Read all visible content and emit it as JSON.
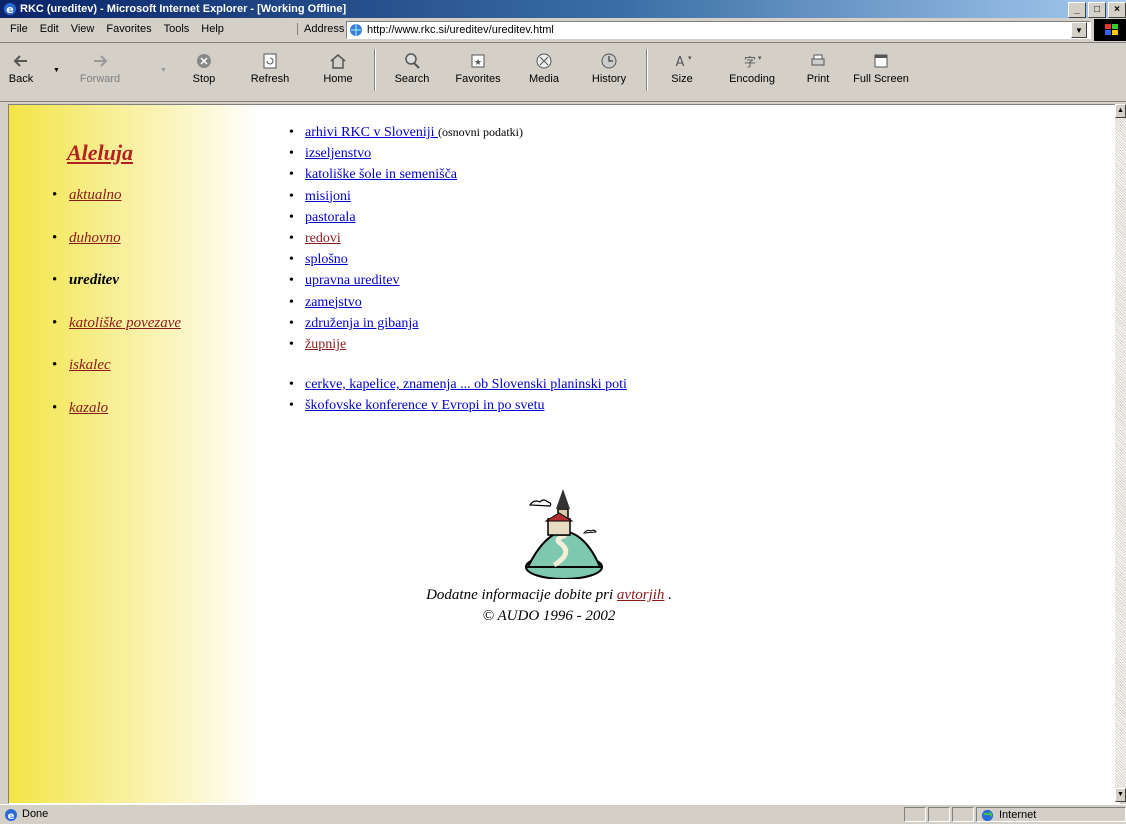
{
  "window": {
    "title": "RKC (ureditev) - Microsoft Internet Explorer - [Working Offline]",
    "buttons": [
      "_",
      "□",
      "×"
    ]
  },
  "menubar": {
    "items": [
      "File",
      "Edit",
      "View",
      "Favorites",
      "Tools",
      "Help"
    ],
    "address_label": "Address",
    "url": "http://www.rkc.si/ureditev/ureditev.html"
  },
  "toolbar": {
    "buttons": [
      {
        "label": "Back",
        "icon": "back-arrow-icon",
        "enabled": true
      },
      {
        "label": "Forward",
        "icon": "forward-arrow-icon",
        "enabled": false
      },
      {
        "label": "Stop",
        "icon": "stop-icon",
        "enabled": true
      },
      {
        "label": "Refresh",
        "icon": "refresh-icon",
        "enabled": true
      },
      {
        "label": "Home",
        "icon": "home-icon",
        "enabled": true
      },
      {
        "label": "Search",
        "icon": "search-icon",
        "enabled": true
      },
      {
        "label": "Favorites",
        "icon": "favorites-icon",
        "enabled": true
      },
      {
        "label": "Media",
        "icon": "media-icon",
        "enabled": true
      },
      {
        "label": "History",
        "icon": "history-icon",
        "enabled": true
      },
      {
        "label": "Size",
        "icon": "text-size-icon",
        "enabled": true
      },
      {
        "label": "Encoding",
        "icon": "encoding-icon",
        "enabled": true
      },
      {
        "label": "Print",
        "icon": "print-icon",
        "enabled": true
      },
      {
        "label": "Full Screen",
        "icon": "full-screen-icon",
        "enabled": true
      }
    ]
  },
  "page": {
    "brand": "Aleluja",
    "nav": [
      {
        "label": "aktualno",
        "current": false
      },
      {
        "label": "duhovno",
        "current": false
      },
      {
        "label": "ureditev",
        "current": true
      },
      {
        "label": "katoliške povezave",
        "current": false
      },
      {
        "label": "iskalec",
        "current": false
      },
      {
        "label": "kazalo",
        "current": false
      }
    ],
    "links": [
      {
        "label": "arhivi RKC v Sloveniji ",
        "note": "(osnovni podatki)",
        "visited": false
      },
      {
        "label": "izseljenstvo",
        "note": "",
        "visited": false
      },
      {
        "label": "katoliške šole in semenišča",
        "note": "",
        "visited": false
      },
      {
        "label": "misijoni",
        "note": "",
        "visited": false
      },
      {
        "label": "pastorala",
        "note": "",
        "visited": false
      },
      {
        "label": "redovi",
        "note": "",
        "visited": true
      },
      {
        "label": "splošno",
        "note": "",
        "visited": false
      },
      {
        "label": "upravna ureditev",
        "note": "",
        "visited": false
      },
      {
        "label": "zamejstvo",
        "note": "",
        "visited": false
      },
      {
        "label": "združenja in gibanja",
        "note": "",
        "visited": false
      },
      {
        "label": "župnije",
        "note": "",
        "visited": true
      }
    ],
    "links2": [
      {
        "label": "cerkve, kapelice, znamenja ... ob Slovenski planinski poti"
      },
      {
        "label": "škofovske konference v Evropi in po svetu"
      }
    ],
    "footer": {
      "text_before": "Dodatne informacije dobite pri ",
      "link": "avtorjih",
      "text_after": " .",
      "copyright": "© AUDO 1996 - 2002"
    }
  },
  "statusbar": {
    "status": "Done",
    "zone": "Internet"
  },
  "colors": {
    "title_gradient_start": "#0a246a",
    "link": "#0000cc",
    "visited_link": "#8b1a1a",
    "brand": "#b22222",
    "sidebar_yellow": "#f3e545"
  }
}
